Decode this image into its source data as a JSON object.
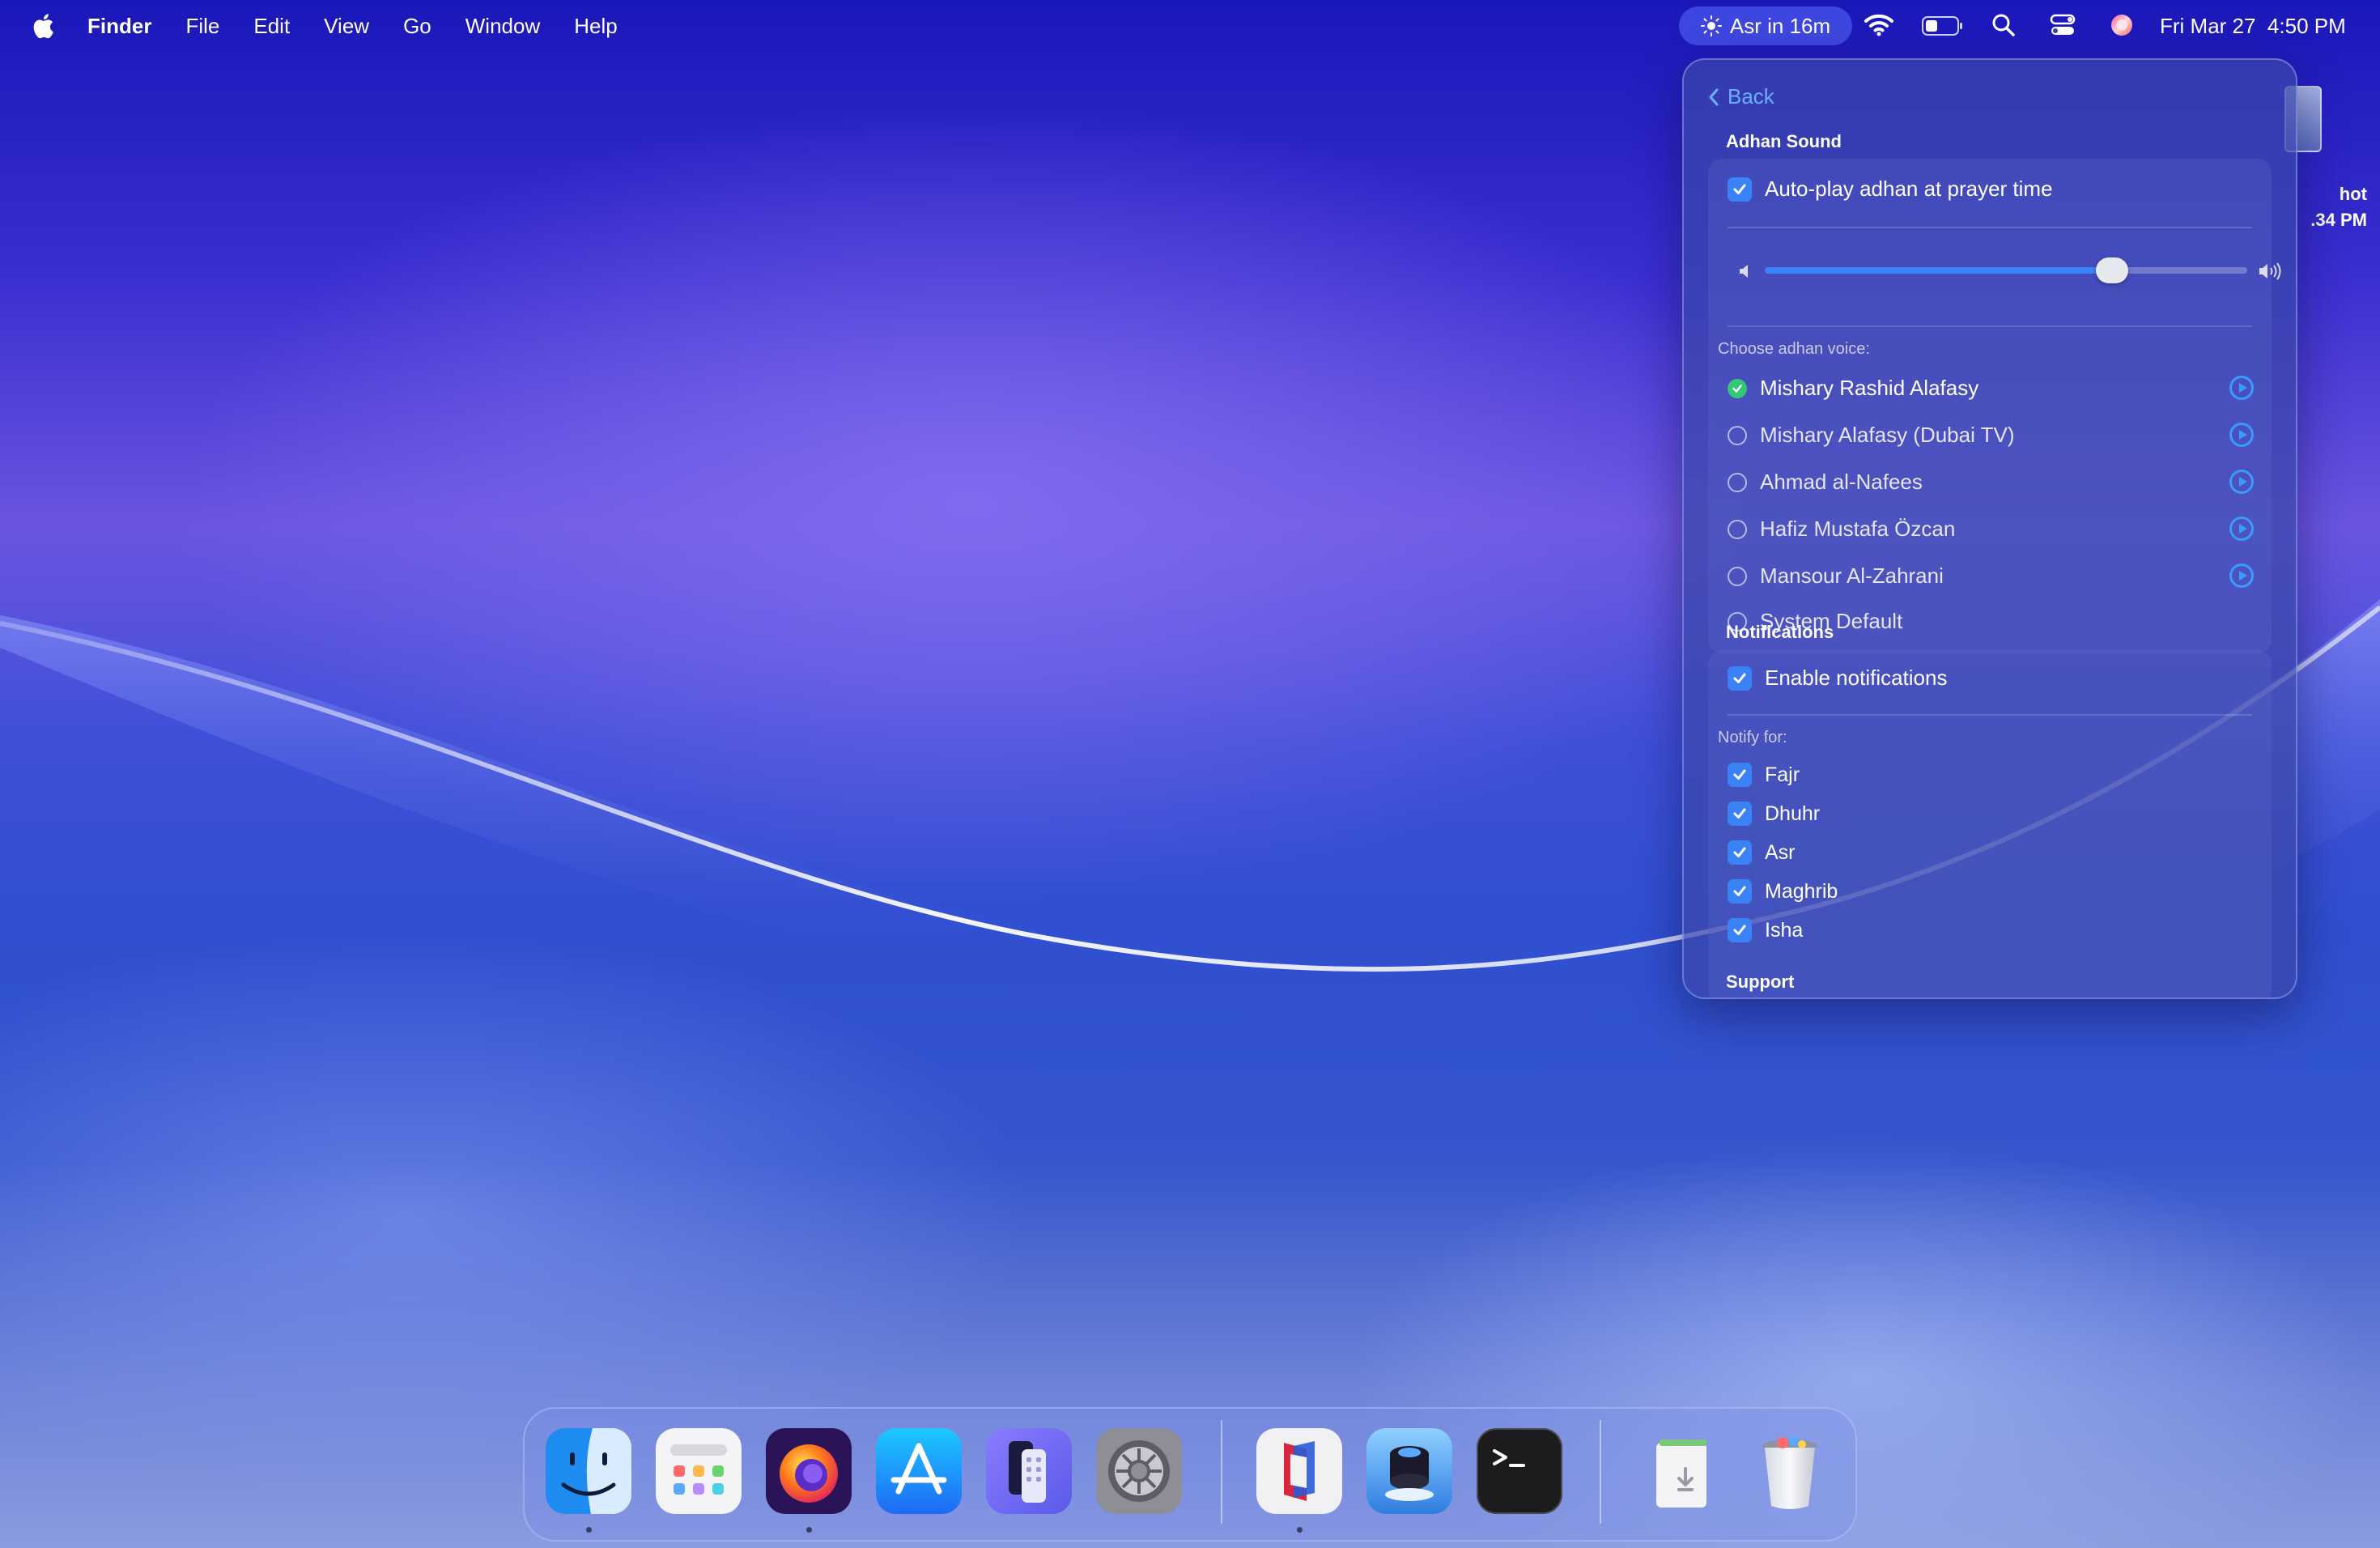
{
  "menubar": {
    "app": "Finder",
    "menus": [
      "File",
      "Edit",
      "View",
      "Go",
      "Window",
      "Help"
    ],
    "prayer_status": "Asr in 16m",
    "date": "Fri Mar 27",
    "time": "4:50 PM"
  },
  "desktop": {
    "item_label_line1": "hot",
    "item_label_line2": ".34 PM"
  },
  "panel": {
    "back_label": "Back",
    "adhan_section_title": "Adhan Sound",
    "autoplay_label": "Auto-play adhan at prayer time",
    "volume_fraction": 0.72,
    "choose_voice_label": "Choose adhan voice:",
    "voices": [
      {
        "name": "Mishary Rashid Alafasy",
        "selected": true
      },
      {
        "name": "Mishary Alafasy (Dubai TV)",
        "selected": false
      },
      {
        "name": "Ahmad al-Nafees",
        "selected": false
      },
      {
        "name": "Hafiz Mustafa Özcan",
        "selected": false
      },
      {
        "name": "Mansour Al-Zahrani",
        "selected": false
      },
      {
        "name": "System Default",
        "selected": false
      }
    ],
    "notifications_title": "Notifications",
    "enable_notifications_label": "Enable notifications",
    "notify_for_label": "Notify for:",
    "prayers": [
      "Fajr",
      "Dhuhr",
      "Asr",
      "Maghrib",
      "Isha"
    ],
    "support_title": "Support"
  },
  "dock": {
    "apps": [
      "finder-icon",
      "launchpad-icon",
      "firefox-icon",
      "app-store-icon",
      "iphone-mirroring-icon",
      "system-settings-icon",
      "parallels-icon",
      "preview-icon",
      "terminal-icon",
      "downloads-icon",
      "trash-icon"
    ]
  },
  "colors": {
    "accent": "#3a82f7",
    "selected_radio": "#34c776",
    "link": "#6ab0ff"
  }
}
